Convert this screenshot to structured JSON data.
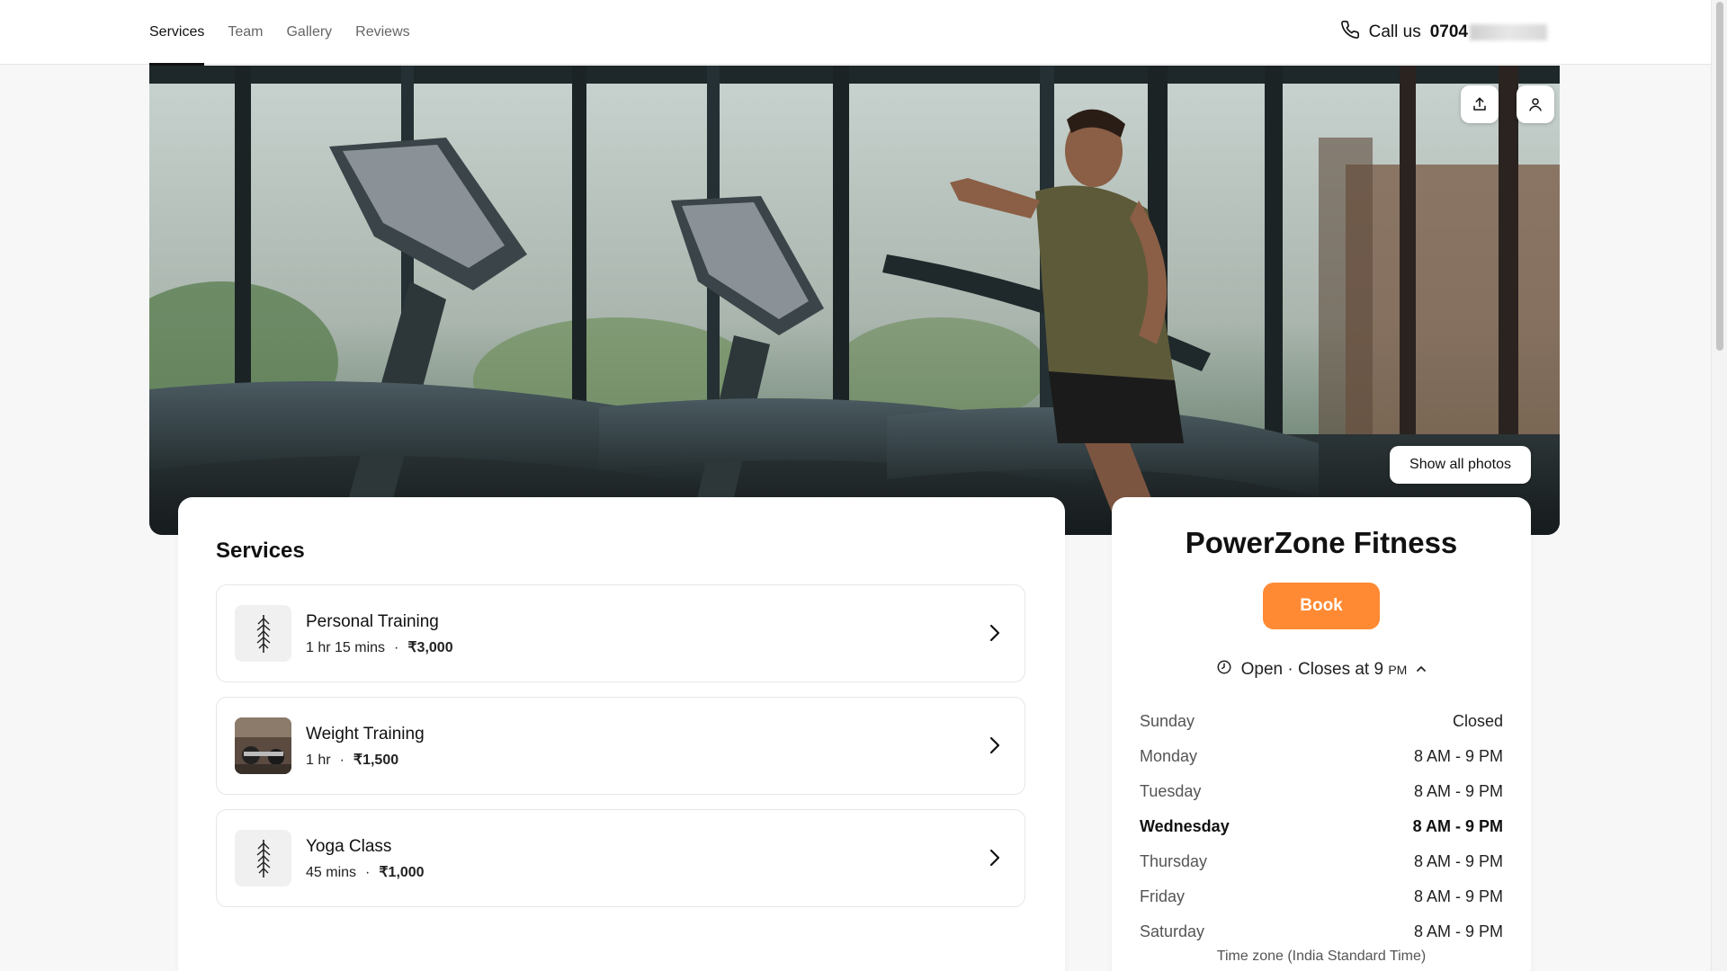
{
  "nav": {
    "tabs": [
      {
        "label": "Services",
        "active": true
      },
      {
        "label": "Team",
        "active": false
      },
      {
        "label": "Gallery",
        "active": false
      },
      {
        "label": "Reviews",
        "active": false
      }
    ],
    "call_label": "Call us",
    "phone_visible": "0704",
    "phone_icon": "phone-icon"
  },
  "hero": {
    "show_all_label": "Show all photos",
    "share_icon": "share-icon",
    "profile_icon": "user-icon"
  },
  "services": {
    "title": "Services",
    "items": [
      {
        "name": "Personal Training",
        "duration": "1 hr 15 mins",
        "price": "₹3,000",
        "thumb": "placeholder-tree-icon"
      },
      {
        "name": "Weight Training",
        "duration": "1 hr",
        "price": "₹1,500",
        "thumb": "gym-photo"
      },
      {
        "name": "Yoga Class",
        "duration": "45 mins",
        "price": "₹1,000",
        "thumb": "placeholder-tree-icon"
      }
    ]
  },
  "business": {
    "name": "PowerZone Fitness",
    "book_label": "Book",
    "status_text": "Open · Closes at 9",
    "status_suffix": "PM",
    "hours": [
      {
        "day": "Sunday",
        "time": "Closed"
      },
      {
        "day": "Monday",
        "time": "8 AM - 9 PM"
      },
      {
        "day": "Tuesday",
        "time": "8 AM - 9 PM"
      },
      {
        "day": "Wednesday",
        "time": "8 AM - 9 PM"
      },
      {
        "day": "Thursday",
        "time": "8 AM - 9 PM"
      },
      {
        "day": "Friday",
        "time": "8 AM - 9 PM"
      },
      {
        "day": "Saturday",
        "time": "8 AM - 9 PM"
      }
    ],
    "today": "Wednesday",
    "timezone": "Time zone (India Standard Time)"
  },
  "colors": {
    "accent": "#ff8a33"
  }
}
